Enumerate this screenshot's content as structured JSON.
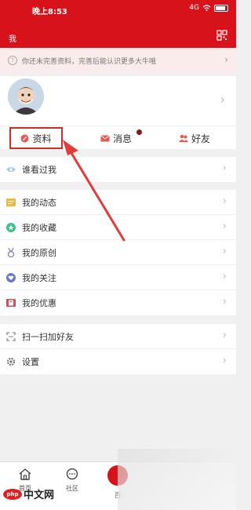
{
  "status_bar": {
    "time": "晚上8:53",
    "signal": "4G",
    "battery": ""
  },
  "header": {
    "title": "我",
    "qr_icon": "qr-scan-icon"
  },
  "notice": {
    "text": "你还未完善资料，完善后能认识更多大牛哦"
  },
  "tabs": [
    {
      "label": "资料",
      "icon": "profile-icon"
    },
    {
      "label": "消息",
      "icon": "mail-icon"
    },
    {
      "label": "好友",
      "icon": "friends-icon"
    }
  ],
  "groups": [
    [
      {
        "label": "谁看过我",
        "icon": "eye-icon"
      }
    ],
    [
      {
        "label": "我的动态",
        "icon": "feed-icon"
      },
      {
        "label": "我的收藏",
        "icon": "star-icon"
      },
      {
        "label": "我的原创",
        "icon": "medal-icon"
      },
      {
        "label": "我的关注",
        "icon": "heart-icon"
      },
      {
        "label": "我的优惠",
        "icon": "coupon-icon"
      }
    ],
    [
      {
        "label": "扫一扫加好友",
        "icon": "scan-icon"
      },
      {
        "label": "设置",
        "icon": "gear-icon"
      }
    ]
  ],
  "bottom_nav": [
    {
      "label": "首页",
      "icon": "home-icon"
    },
    {
      "label": "社区",
      "icon": "chat-icon"
    },
    {
      "label": "百",
      "icon": "video-icon"
    }
  ],
  "watermark": {
    "logo": "php",
    "text": "中文网"
  },
  "colors": {
    "brand_red": "#d8121b",
    "highlight": "#c9302c"
  }
}
